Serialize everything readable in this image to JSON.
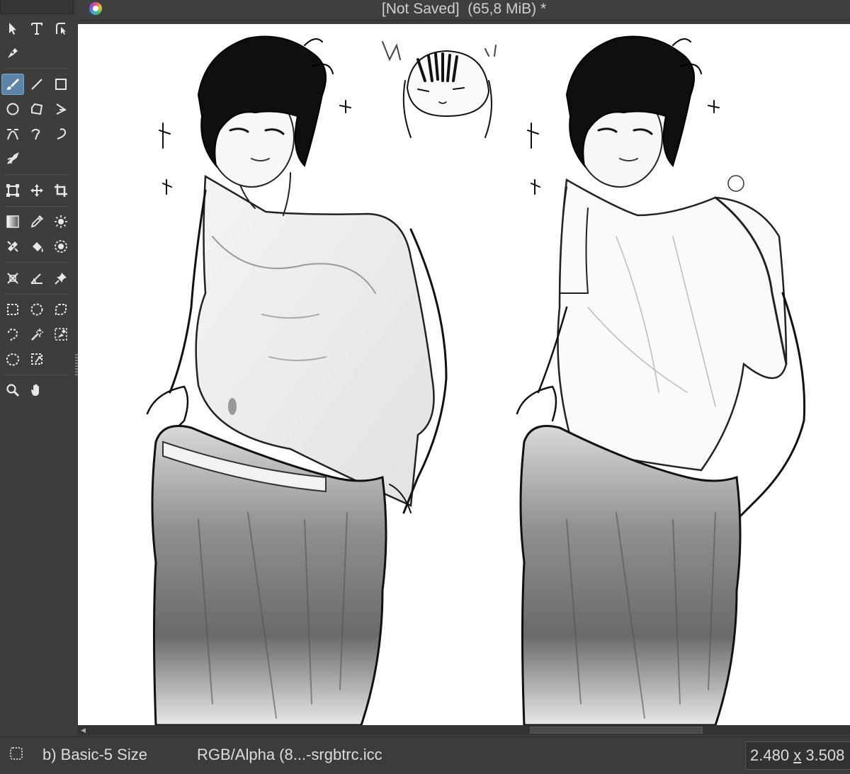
{
  "window": {
    "title_status": "[Not Saved]",
    "title_size": "(65,8 MiB) *"
  },
  "toolbox": {
    "tools": [
      {
        "name": "select-shapes",
        "icon": "arrow-pointer-icon"
      },
      {
        "name": "text",
        "icon": "text-icon"
      },
      {
        "name": "edit-shapes",
        "icon": "edit-shapes-icon"
      },
      {
        "name": "calligraphy",
        "icon": "calligraphy-pen-icon"
      },
      {
        "name": "freehand-brush",
        "icon": "brush-icon",
        "active": true
      },
      {
        "name": "line",
        "icon": "line-icon"
      },
      {
        "name": "rectangle",
        "icon": "rectangle-icon"
      },
      {
        "name": "ellipse",
        "icon": "ellipse-icon"
      },
      {
        "name": "polygon",
        "icon": "polygon-icon"
      },
      {
        "name": "polyline",
        "icon": "polyline-icon"
      },
      {
        "name": "bezier-curve",
        "icon": "bezier-icon"
      },
      {
        "name": "freehand-path",
        "icon": "freehand-path-icon"
      },
      {
        "name": "dynamic-brush",
        "icon": "dynamic-brush-icon"
      },
      {
        "name": "multibrush",
        "icon": "multibrush-icon"
      },
      {
        "name": "transform",
        "icon": "transform-icon"
      },
      {
        "name": "move",
        "icon": "move-icon"
      },
      {
        "name": "crop",
        "icon": "crop-icon"
      },
      {
        "name": "gradient",
        "icon": "gradient-icon"
      },
      {
        "name": "color-picker",
        "icon": "eyedropper-icon"
      },
      {
        "name": "colorize-mask",
        "icon": "colorize-mask-icon"
      },
      {
        "name": "smart-patch",
        "icon": "smart-patch-icon"
      },
      {
        "name": "fill",
        "icon": "paint-bucket-icon"
      },
      {
        "name": "enclose-and-fill",
        "icon": "enclose-fill-icon"
      },
      {
        "name": "assistant",
        "icon": "assistant-icon"
      },
      {
        "name": "measure",
        "icon": "measure-icon"
      },
      {
        "name": "reference-images",
        "icon": "pin-icon"
      },
      {
        "name": "rectangular-selection",
        "icon": "rect-select-icon"
      },
      {
        "name": "elliptical-selection",
        "icon": "ellipse-select-icon"
      },
      {
        "name": "polygonal-selection",
        "icon": "polygon-select-icon"
      },
      {
        "name": "freehand-selection",
        "icon": "freehand-select-icon"
      },
      {
        "name": "contiguous-selection",
        "icon": "magic-wand-icon"
      },
      {
        "name": "similar-color-selection",
        "icon": "similar-select-icon"
      },
      {
        "name": "bezier-selection",
        "icon": "bezier-select-icon"
      },
      {
        "name": "magnetic-selection",
        "icon": "magnetic-select-icon"
      },
      {
        "name": "zoom",
        "icon": "zoom-icon"
      },
      {
        "name": "pan",
        "icon": "hand-icon"
      }
    ]
  },
  "statusbar": {
    "brush_preset": "b) Basic-5 Size",
    "color_profile": "RGB/Alpha (8...-srgbtrc.icc",
    "dims_w": "2.480",
    "dims_x": "x",
    "dims_h": "3.508"
  },
  "colors": {
    "panel": "#3c3c3c",
    "canvas": "#ffffff",
    "active_tool": "#5b84a8"
  }
}
